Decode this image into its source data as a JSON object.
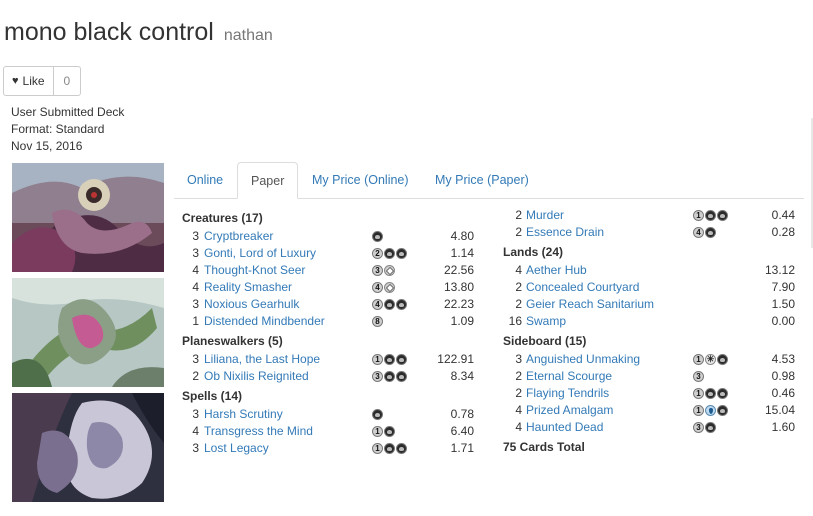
{
  "deck": {
    "title": "mono black control",
    "author": "nathan",
    "like_label": "Like",
    "like_count": "0",
    "meta": [
      "User Submitted Deck",
      "Format: Standard",
      "Nov 15, 2016"
    ]
  },
  "art": [
    "Gonti, Lord of Luxury art",
    "Noxious Gearhulk art",
    "Distended Mindbender art"
  ],
  "tabs": [
    {
      "label": "Online",
      "active": false
    },
    {
      "label": "Paper",
      "active": true
    },
    {
      "label": "My Price (Online)",
      "active": false
    },
    {
      "label": "My Price (Paper)",
      "active": false
    }
  ],
  "left_sections": [
    {
      "title": "Creatures (17)",
      "cards": [
        {
          "qty": "3",
          "name": "Cryptbreaker",
          "mana": [
            "B"
          ],
          "price": "4.80"
        },
        {
          "qty": "3",
          "name": "Gonti, Lord of Luxury",
          "mana": [
            "2",
            "B",
            "B"
          ],
          "price": "1.14"
        },
        {
          "qty": "4",
          "name": "Thought-Knot Seer",
          "mana": [
            "3",
            "C"
          ],
          "price": "22.56"
        },
        {
          "qty": "4",
          "name": "Reality Smasher",
          "mana": [
            "4",
            "C"
          ],
          "price": "13.80"
        },
        {
          "qty": "3",
          "name": "Noxious Gearhulk",
          "mana": [
            "4",
            "B",
            "B"
          ],
          "price": "22.23"
        },
        {
          "qty": "1",
          "name": "Distended Mindbender",
          "mana": [
            "8"
          ],
          "price": "1.09"
        }
      ]
    },
    {
      "title": "Planeswalkers (5)",
      "cards": [
        {
          "qty": "3",
          "name": "Liliana, the Last Hope",
          "mana": [
            "1",
            "B",
            "B"
          ],
          "price": "122.91"
        },
        {
          "qty": "2",
          "name": "Ob Nixilis Reignited",
          "mana": [
            "3",
            "B",
            "B"
          ],
          "price": "8.34"
        }
      ]
    },
    {
      "title": "Spells (14)",
      "cards": [
        {
          "qty": "3",
          "name": "Harsh Scrutiny",
          "mana": [
            "B"
          ],
          "price": "0.78"
        },
        {
          "qty": "4",
          "name": "Transgress the Mind",
          "mana": [
            "1",
            "B"
          ],
          "price": "6.40"
        },
        {
          "qty": "3",
          "name": "Lost Legacy",
          "mana": [
            "1",
            "B",
            "B"
          ],
          "price": "1.71"
        }
      ]
    }
  ],
  "right_top_cards": [
    {
      "qty": "2",
      "name": "Murder",
      "mana": [
        "1",
        "B",
        "B"
      ],
      "price": "0.44"
    },
    {
      "qty": "2",
      "name": "Essence Drain",
      "mana": [
        "4",
        "B"
      ],
      "price": "0.28"
    }
  ],
  "right_sections": [
    {
      "title": "Lands (24)",
      "cards": [
        {
          "qty": "4",
          "name": "Aether Hub",
          "mana": [],
          "price": "13.12"
        },
        {
          "qty": "2",
          "name": "Concealed Courtyard",
          "mana": [],
          "price": "7.90"
        },
        {
          "qty": "2",
          "name": "Geier Reach Sanitarium",
          "mana": [],
          "price": "1.50"
        },
        {
          "qty": "16",
          "name": "Swamp",
          "mana": [],
          "price": "0.00"
        }
      ]
    },
    {
      "title": "Sideboard (15)",
      "cards": [
        {
          "qty": "3",
          "name": "Anguished Unmaking",
          "mana": [
            "1",
            "W",
            "B"
          ],
          "price": "4.53"
        },
        {
          "qty": "2",
          "name": "Eternal Scourge",
          "mana": [
            "3"
          ],
          "price": "0.98"
        },
        {
          "qty": "2",
          "name": "Flaying Tendrils",
          "mana": [
            "1",
            "B",
            "B"
          ],
          "price": "0.46"
        },
        {
          "qty": "4",
          "name": "Prized Amalgam",
          "mana": [
            "1",
            "U",
            "B"
          ],
          "price": "15.04"
        },
        {
          "qty": "4",
          "name": "Haunted Dead",
          "mana": [
            "3",
            "B"
          ],
          "price": "1.60"
        }
      ]
    }
  ],
  "total_label": "75 Cards Total",
  "colors": {
    "link": "#337ab7",
    "text": "#333333",
    "muted": "#777777",
    "border": "#dddddd"
  }
}
